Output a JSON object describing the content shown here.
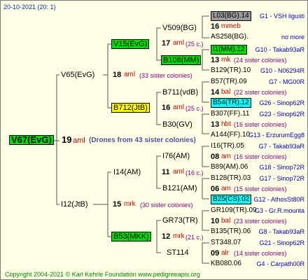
{
  "header": "20-10-2021 (20: 1)",
  "root": {
    "name": "V67(EvG)",
    "num": "19",
    "yr": "aml",
    "note": "(Drones from 43 sister colonies)"
  },
  "gen1": [
    {
      "name": "V65(EvG)"
    },
    {
      "name": "I12(JtB)"
    }
  ],
  "gen2": [
    {
      "name": "V15(EvG)",
      "num": "17",
      "yr": "aml",
      "sis": "(25 c.)"
    },
    {
      "name": "B712(JtB)",
      "num": "16",
      "yr": "aml",
      "sis": "(25 c.)"
    },
    {
      "name": "I14(AM)",
      "num": "11",
      "yr": "aml",
      "sis": "(16 c.)"
    },
    {
      "name": "B53(MKK)",
      "num": "12",
      "yr": "mrk",
      "sis": "(21 c.)"
    }
  ],
  "gen1_info": [
    {
      "num": "18",
      "yr": "aml",
      "sis": "(33 sister colonies)"
    },
    {
      "num": "15",
      "yr": "mrk",
      "sis": "(30 sister colonies)"
    }
  ],
  "gen3": [
    {
      "name": "V509(BG)"
    },
    {
      "name": "B108(MM)"
    },
    {
      "name": "B711(vdB)"
    },
    {
      "name": "B30(GV)"
    },
    {
      "name": "I76(AM)"
    },
    {
      "name": "B121(AM)"
    },
    {
      "name": "GR73(TR)"
    },
    {
      "name": "ST114"
    }
  ],
  "gen4": [
    {
      "name": "L03(BG).14",
      "ref": "G1 - VSH ligusti"
    },
    {
      "num": "16",
      "yr": "mmeb"
    },
    {
      "name": "AS258(BG).",
      "ref": "no more"
    },
    {
      "name": "I1(MM).12",
      "ref": "G10 - Takab93aR"
    },
    {
      "num": "13",
      "yr": "mk",
      "sis": "(24 sister colonies)"
    },
    {
      "name": "B129(TR).10",
      "ref": "G10 - N06294R"
    },
    {
      "name": "B57(TR).09",
      "ref": "G7 - MG00R"
    },
    {
      "num": "14",
      "yr": "bal",
      "sis": "(22 sister colonies)"
    },
    {
      "name": "B54(TR).12",
      "ref": "G26 - Sinop62R"
    },
    {
      "name": "B307(FF).11",
      "ref": "G23 - Sinop62R"
    },
    {
      "num": "13",
      "yr": "hbt",
      "sis": "(16 sister colonies)"
    },
    {
      "name": "A144(FF).10",
      "ref": "G13 - ErzurumEgg8"
    },
    {
      "name": "I16(TR).05",
      "ref": "G7 - Takab93aR"
    },
    {
      "num": "08",
      "yr": "am",
      "sis": "(16 sister colonies)"
    },
    {
      "name": "B89(AM).06",
      "ref": "G18 - Sinop72R"
    },
    {
      "name": "B128(TR).03",
      "ref": "G17 - Sinop72R"
    },
    {
      "num": "06",
      "yr": "am",
      "sis": "(15 sister colonies)"
    },
    {
      "name": "B25(CS).02",
      "ref": "G12 - AthosSt80R"
    },
    {
      "name": "GR109(TR).09",
      "ref": "G3 - Gr.R.mounta"
    },
    {
      "num": "10",
      "yr": "bal",
      "sis": "(23 sister colonies)"
    },
    {
      "name": "B135(TR).06",
      "ref": "G8 - Takab93aR"
    },
    {
      "name": "ST348.07",
      "ref": "G21 - Sinop62R"
    },
    {
      "num": "09",
      "yr": "alr",
      "sis": "(14 sister colonies)"
    },
    {
      "name": "KB080.06",
      "ref": "G4 - Carpath00R"
    }
  ],
  "footer": "Copyright 2004-2021 © Karl Kehrle Foundation    www.pedigreeapis.org",
  "colors": {
    "bg": "#ffffe6",
    "green": "#00dd00",
    "yellow": "#ffff00",
    "cyan": "#00ffff",
    "grey": "#999999"
  }
}
